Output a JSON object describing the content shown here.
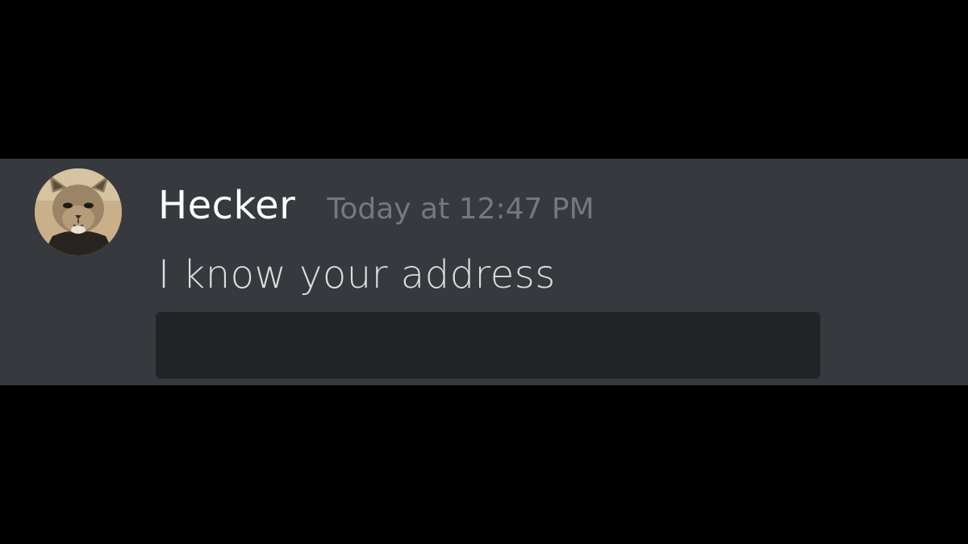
{
  "message": {
    "author": "Hecker",
    "timestamp": "Today at 12:47 PM",
    "content": "I know your address",
    "avatar_icon": "cat-avatar-icon"
  },
  "colors": {
    "background": "#000000",
    "message_row": "#36393e",
    "username": "#ffffff",
    "timestamp": "#75787d",
    "content": "#dcddde",
    "embed": "#222428"
  }
}
